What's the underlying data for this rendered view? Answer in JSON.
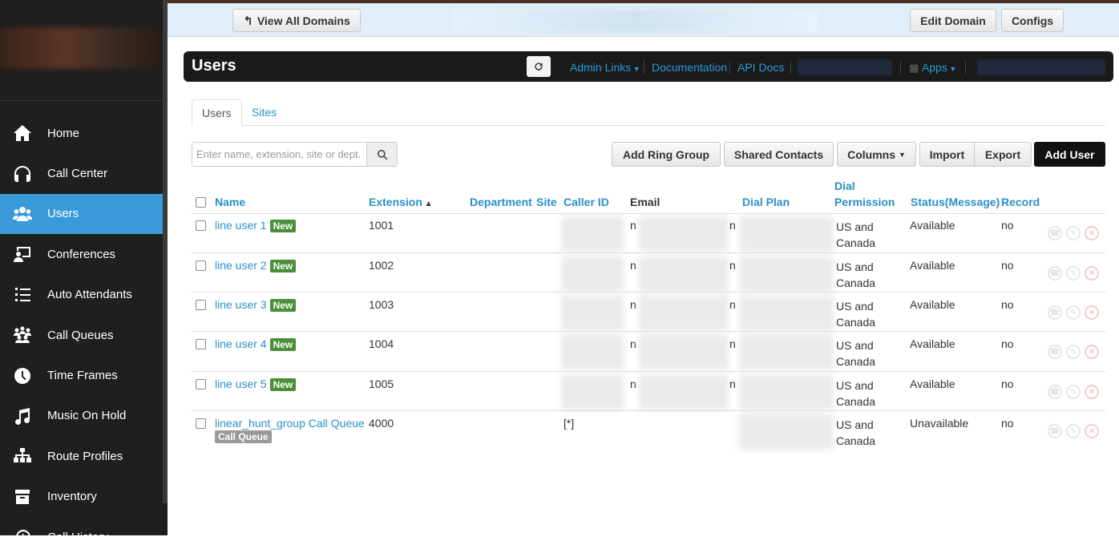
{
  "topbar": {
    "view_all_domains": "View All Domains",
    "edit_domain": "Edit Domain",
    "configs": "Configs"
  },
  "sidebar": {
    "items": [
      {
        "label": "Home",
        "icon": "home-icon"
      },
      {
        "label": "Call Center",
        "icon": "headset-icon"
      },
      {
        "label": "Users",
        "icon": "users-icon"
      },
      {
        "label": "Conferences",
        "icon": "conference-icon"
      },
      {
        "label": "Auto Attendants",
        "icon": "list-icon"
      },
      {
        "label": "Call Queues",
        "icon": "queue-icon"
      },
      {
        "label": "Time Frames",
        "icon": "clock-icon"
      },
      {
        "label": "Music On Hold",
        "icon": "music-icon"
      },
      {
        "label": "Route Profiles",
        "icon": "sitemap-icon"
      },
      {
        "label": "Inventory",
        "icon": "box-icon"
      },
      {
        "label": "Call History",
        "icon": "history-icon"
      }
    ]
  },
  "header": {
    "title": "Users",
    "admin_links": "Admin Links",
    "documentation": "Documentation",
    "api_docs": "API Docs",
    "apps": "Apps"
  },
  "tabs": [
    "Users",
    "Sites"
  ],
  "search": {
    "placeholder": "Enter name, extension, site or dept."
  },
  "actions": {
    "add_ring_group": "Add Ring Group",
    "shared_contacts": "Shared Contacts",
    "columns": "Columns",
    "import": "Import",
    "export": "Export",
    "add_user": "Add User"
  },
  "table": {
    "headers": {
      "name": "Name",
      "extension": "Extension",
      "department": "Department",
      "site": "Site",
      "caller_id": "Caller ID",
      "email": "Email",
      "dial_plan": "Dial Plan",
      "dial_permission_1": "Dial",
      "dial_permission_2": "Permission",
      "status": "Status(Message)",
      "record": "Record"
    },
    "rows": [
      {
        "name": "line user 1",
        "badge": "New",
        "extension": "1001",
        "email_prefix": "n",
        "email_suffix": "n",
        "perm1": "US and",
        "perm2": "Canada",
        "status": "Available",
        "record": "no"
      },
      {
        "name": "line user 2",
        "badge": "New",
        "extension": "1002",
        "email_prefix": "n",
        "email_suffix": "n",
        "perm1": "US and",
        "perm2": "Canada",
        "status": "Available",
        "record": "no"
      },
      {
        "name": "line user 3",
        "badge": "New",
        "extension": "1003",
        "email_prefix": "n",
        "email_suffix": "n",
        "perm1": "US and",
        "perm2": "Canada",
        "status": "Available",
        "record": "no"
      },
      {
        "name": "line user 4",
        "badge": "New",
        "extension": "1004",
        "email_prefix": "n",
        "email_suffix": "n",
        "perm1": "US and",
        "perm2": "Canada",
        "status": "Available",
        "record": "no"
      },
      {
        "name": "line user 5",
        "badge": "New",
        "extension": "1005",
        "email_prefix": "n",
        "email_suffix": "n",
        "perm1": "US and",
        "perm2": "Canada",
        "status": "Available",
        "record": "no"
      },
      {
        "name": "linear_hunt_group Call Queue",
        "badge": "Call Queue",
        "extension": "4000",
        "caller_id": "[*]",
        "perm1": "US and",
        "perm2": "Canada",
        "status": "Unavailable",
        "record": "no"
      }
    ]
  },
  "colors": {
    "accent": "#3a9ad9",
    "link": "#2a8fc6",
    "new_badge": "#4a8f3a",
    "sidebar_bg": "#1f1f1f",
    "header_bg": "#1a1a1a"
  }
}
